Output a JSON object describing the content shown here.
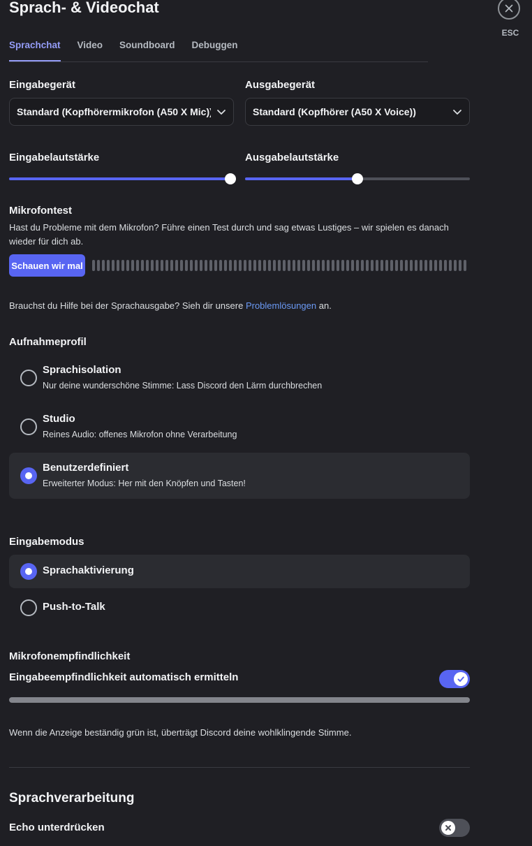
{
  "header": {
    "title": "Sprach- & Videochat",
    "esc_label": "ESC"
  },
  "tabs": [
    {
      "label": "Sprachchat",
      "active": true
    },
    {
      "label": "Video"
    },
    {
      "label": "Soundboard"
    },
    {
      "label": "Debuggen"
    }
  ],
  "devices": {
    "input_label": "Eingabegerät",
    "input_value": "Standard (Kopfhörermikrofon (A50 X Mic))",
    "output_label": "Ausgabegerät",
    "output_value": "Standard (Kopfhörer (A50 X Voice))"
  },
  "volume": {
    "input_label": "Eingabelautstärke",
    "input_level": 1.0,
    "output_label": "Ausgabelautstärke",
    "output_level": 0.5
  },
  "mic_test": {
    "title": "Mikrofontest",
    "description": "Hast du Probleme mit dem Mikrofon? Führe einen Test durch und sag etwas Lustiges – wir spielen es danach wieder für dich ab.",
    "button_label": "Schauen wir mal"
  },
  "help": {
    "prefix": "Brauchst du Hilfe bei der Sprachausgabe? Sieh dir unsere ",
    "link": "Problemlösungen",
    "suffix": " an."
  },
  "profile": {
    "title": "Aufnahmeprofil",
    "options": [
      {
        "title": "Sprachisolation",
        "desc": "Nur deine wunderschöne Stimme: Lass Discord den Lärm durchbrechen"
      },
      {
        "title": "Studio",
        "desc": "Reines Audio: offenes Mikrofon ohne Verarbeitung"
      },
      {
        "title": "Benutzerdefiniert",
        "desc": "Erweiterter Modus: Her mit den Knöpfen und Tasten!",
        "selected": true
      }
    ]
  },
  "input_mode": {
    "title": "Eingabemodus",
    "options": [
      {
        "title": "Sprachaktivierung",
        "selected": true
      },
      {
        "title": "Push-to-Talk"
      }
    ]
  },
  "sensitivity": {
    "title": "Mikrofonempfindlichkeit",
    "auto_label": "Eingabeempfindlichkeit automatisch ermitteln",
    "auto_enabled": true,
    "note": "Wenn die Anzeige beständig grün ist, überträgt Discord deine wohlklingende Stimme."
  },
  "processing": {
    "title": "Sprachverarbeitung",
    "echo_label": "Echo unterdrücken",
    "echo_enabled": false
  },
  "colors": {
    "accent": "#5865f2",
    "background": "#1f1f24",
    "link": "#6b9af5"
  }
}
